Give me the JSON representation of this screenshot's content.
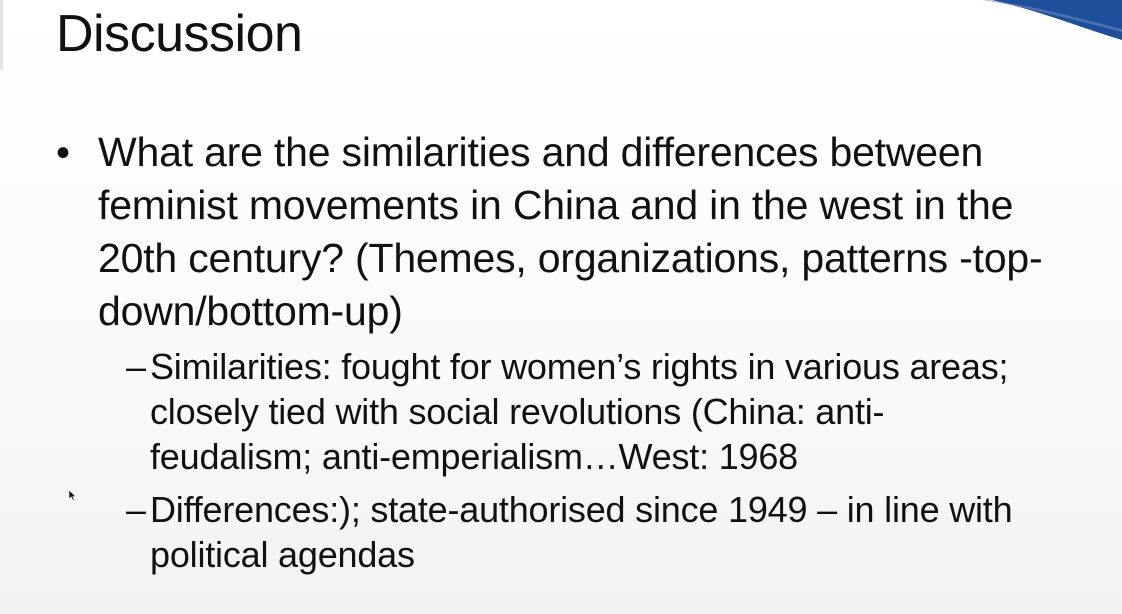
{
  "slide": {
    "title": "Discussion",
    "bullets": [
      {
        "marker": "•",
        "text": "What are the similarities and differences between feminist movements in China and in the west in the 20th century? (Themes, organizations, patterns -top-down/bottom-up)",
        "sub_items": [
          {
            "marker": "–",
            "text": "Similarities: fought for women’s rights in various areas; closely tied with social revolutions (China: anti-feudalism; anti-emperialism…West: 1968"
          },
          {
            "marker": "–",
            "text": "Differences:); state-authorised since 1949 – in line with political agendas"
          }
        ]
      }
    ]
  },
  "colors": {
    "accent": "#1f4e9a",
    "text": "#111111"
  }
}
